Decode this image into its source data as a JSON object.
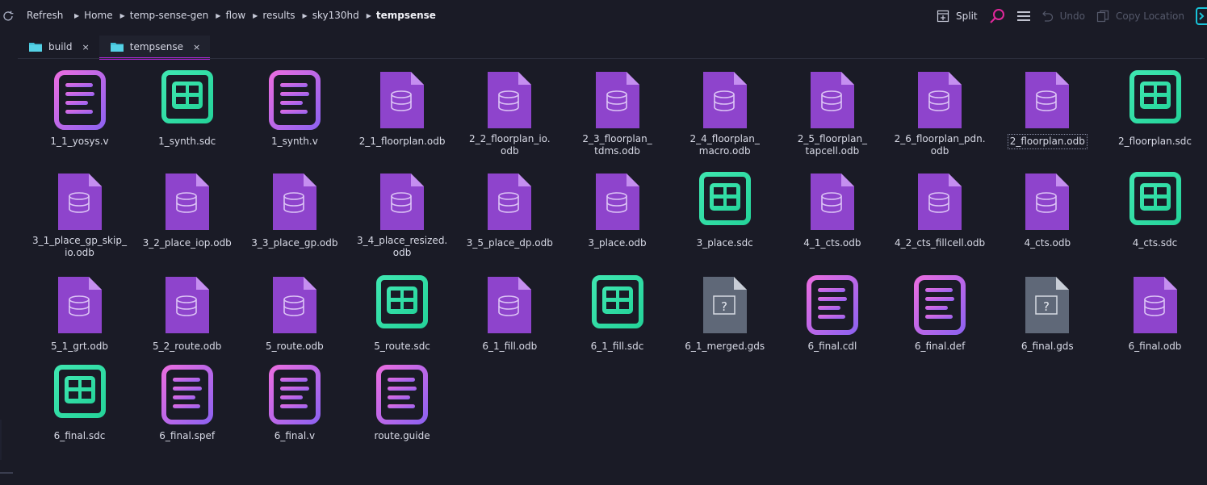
{
  "toolbar": {
    "refresh_label": "Refresh",
    "breadcrumb": [
      "Home",
      "temp-sense-gen",
      "flow",
      "results",
      "sky130hd",
      "tempsense"
    ],
    "split_label": "Split",
    "undo_label": "Undo",
    "copy_location_label": "Copy Location"
  },
  "tabs": [
    {
      "label": "build",
      "close": "×"
    },
    {
      "label": "tempsense",
      "close": "×"
    }
  ],
  "colors": {
    "accent": "#b028d8",
    "odb": "#8a3fc9",
    "sdc": "#2fe6a6",
    "text_file": "#b65ce8",
    "gds": "#5f6878"
  },
  "files": [
    {
      "name": "1_1_yosys.v",
      "icon": "text-doc-icon"
    },
    {
      "name": "1_synth.sdc",
      "icon": "table-icon"
    },
    {
      "name": "1_synth.v",
      "icon": "text-doc-icon"
    },
    {
      "name": "2_1_floorplan.odb",
      "icon": "database-file-icon"
    },
    {
      "name": "2_2_floorplan_io.\nodb",
      "icon": "database-file-icon"
    },
    {
      "name": "2_3_floorplan_\ntdms.odb",
      "icon": "database-file-icon"
    },
    {
      "name": "2_4_floorplan_\nmacro.odb",
      "icon": "database-file-icon"
    },
    {
      "name": "2_5_floorplan_\ntapcell.odb",
      "icon": "database-file-icon"
    },
    {
      "name": "2_6_floorplan_pdn.\nodb",
      "icon": "database-file-icon"
    },
    {
      "name": "2_floorplan.odb",
      "icon": "database-file-icon",
      "selected": true
    },
    {
      "name": "2_floorplan.sdc",
      "icon": "table-icon"
    },
    {
      "name": "3_1_place_gp_skip_\nio.odb",
      "icon": "database-file-icon"
    },
    {
      "name": "3_2_place_iop.odb",
      "icon": "database-file-icon"
    },
    {
      "name": "3_3_place_gp.odb",
      "icon": "database-file-icon"
    },
    {
      "name": "3_4_place_resized.\nodb",
      "icon": "database-file-icon"
    },
    {
      "name": "3_5_place_dp.odb",
      "icon": "database-file-icon"
    },
    {
      "name": "3_place.odb",
      "icon": "database-file-icon"
    },
    {
      "name": "3_place.sdc",
      "icon": "table-icon"
    },
    {
      "name": "4_1_cts.odb",
      "icon": "database-file-icon"
    },
    {
      "name": "4_2_cts_fillcell.odb",
      "icon": "database-file-icon"
    },
    {
      "name": "4_cts.odb",
      "icon": "database-file-icon"
    },
    {
      "name": "4_cts.sdc",
      "icon": "table-icon"
    },
    {
      "name": "5_1_grt.odb",
      "icon": "database-file-icon"
    },
    {
      "name": "5_2_route.odb",
      "icon": "database-file-icon"
    },
    {
      "name": "5_route.odb",
      "icon": "database-file-icon"
    },
    {
      "name": "5_route.sdc",
      "icon": "table-icon"
    },
    {
      "name": "6_1_fill.odb",
      "icon": "database-file-icon"
    },
    {
      "name": "6_1_fill.sdc",
      "icon": "table-icon"
    },
    {
      "name": "6_1_merged.gds",
      "icon": "unknown-file-icon"
    },
    {
      "name": "6_final.cdl",
      "icon": "text-doc-icon"
    },
    {
      "name": "6_final.def",
      "icon": "text-doc-icon"
    },
    {
      "name": "6_final.gds",
      "icon": "unknown-file-icon"
    },
    {
      "name": "6_final.odb",
      "icon": "database-file-icon"
    },
    {
      "name": "6_final.sdc",
      "icon": "table-icon"
    },
    {
      "name": "6_final.spef",
      "icon": "text-doc-icon"
    },
    {
      "name": "6_final.v",
      "icon": "text-doc-icon"
    },
    {
      "name": "route.guide",
      "icon": "text-doc-icon"
    }
  ]
}
